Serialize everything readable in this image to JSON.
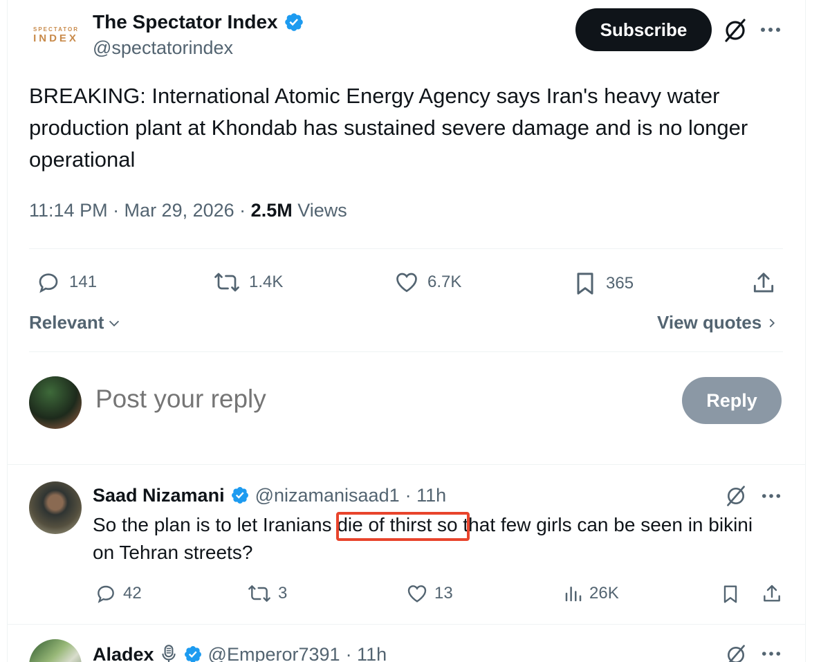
{
  "post": {
    "author_name": "The Spectator Index",
    "author_handle": "@spectatorindex",
    "logo_line1": "SPECTATOR",
    "logo_line2": "INDEX",
    "subscribe_label": "Subscribe",
    "text": "BREAKING: International Atomic Energy Agency says Iran's heavy water production plant at Khondab has sustained severe damage and is no longer operational",
    "time": "11:14 PM · Mar 29, 2026 ·",
    "views_count": "2.5M",
    "views_label": "Views",
    "stats": {
      "replies": "141",
      "reposts": "1.4K",
      "likes": "6.7K",
      "bookmarks": "365"
    }
  },
  "replies_header": {
    "sort_label": "Relevant",
    "view_quotes_label": "View quotes"
  },
  "composer": {
    "placeholder": "Post your reply",
    "reply_label": "Reply"
  },
  "replies": [
    {
      "name": "Saad Nizamani",
      "handle": "@nizamanisaad1",
      "time": "· 11h",
      "text": "So the plan is to let Iranians die of thirst so that few girls can be seen in bikini on Tehran streets?",
      "replies": "42",
      "reposts": "3",
      "likes": "13",
      "views": "26K"
    },
    {
      "name": "Aladex",
      "handle": "@Emperor7391",
      "time": "· 11h"
    }
  ],
  "colors": {
    "verified": "#1d9bf0",
    "highlight_box": "#e8442c",
    "muted_text": "#536471",
    "subscribe_bg": "#0f1419",
    "reply_button_bg": "#8b98a5"
  },
  "icons": [
    "verified-badge-icon",
    "grok-icon",
    "more-icon",
    "reply-icon",
    "repost-icon",
    "like-icon",
    "bookmark-icon",
    "share-icon",
    "views-icon",
    "chevron-down-icon",
    "chevron-right-icon",
    "podcast-mic-icon"
  ]
}
